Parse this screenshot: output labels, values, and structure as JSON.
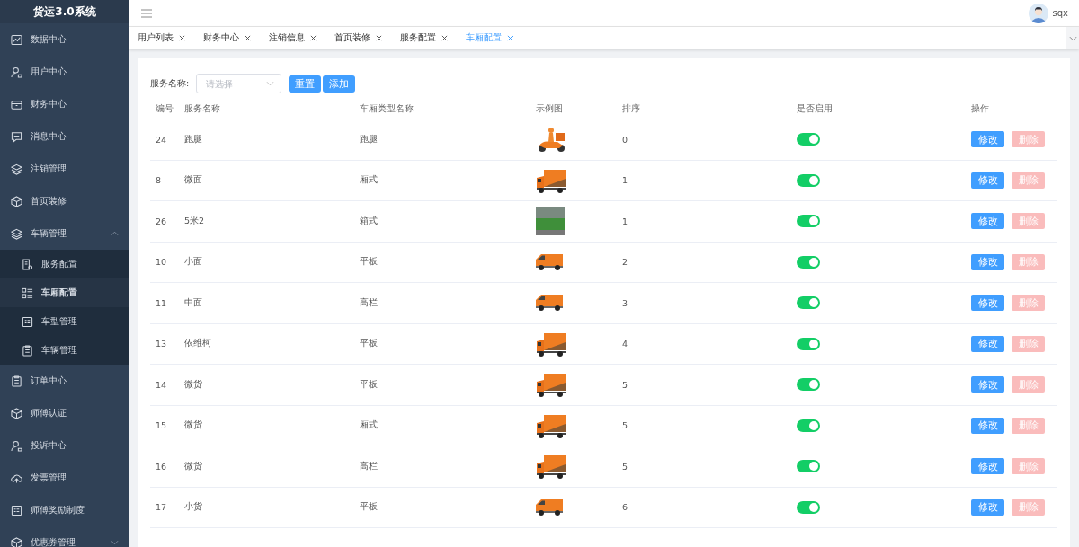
{
  "app_title": "货运3.0系统",
  "sidebar": {
    "items": [
      {
        "label": "数据中心",
        "selected": false
      },
      {
        "label": "用户中心",
        "selected": false
      },
      {
        "label": "财务中心",
        "selected": false
      },
      {
        "label": "消息中心",
        "selected": false
      },
      {
        "label": "注销管理",
        "selected": false
      },
      {
        "label": "首页装修",
        "selected": false
      },
      {
        "label": "车辆管理",
        "selected": false,
        "expanded": true,
        "children": [
          {
            "label": "服务配置",
            "selected": false
          },
          {
            "label": "车厢配置",
            "selected": true
          },
          {
            "label": "车型管理",
            "selected": false
          },
          {
            "label": "车辆管理",
            "selected": false
          }
        ]
      },
      {
        "label": "订单中心",
        "selected": false
      },
      {
        "label": "师傅认证",
        "selected": false
      },
      {
        "label": "投诉中心",
        "selected": false
      },
      {
        "label": "发票管理",
        "selected": false
      },
      {
        "label": "师傅奖励制度",
        "selected": false
      },
      {
        "label": "优惠券管理",
        "selected": false,
        "expanded": false
      }
    ]
  },
  "user": {
    "name": "sqx"
  },
  "tabs": [
    {
      "label": "用户列表",
      "selected": false
    },
    {
      "label": "财务中心",
      "selected": false
    },
    {
      "label": "注销信息",
      "selected": false
    },
    {
      "label": "首页装修",
      "selected": false
    },
    {
      "label": "服务配置",
      "selected": false
    },
    {
      "label": "车厢配置",
      "selected": true
    }
  ],
  "filter": {
    "label": "服务名称:",
    "placeholder": "请选择",
    "buttons": [
      "重置",
      "添加"
    ]
  },
  "table": {
    "columns": [
      "编号",
      "服务名称",
      "车厢类型名称",
      "示例图",
      "排序",
      "是否启用",
      "操作"
    ],
    "rows": [
      {
        "id": "24",
        "service": "跑腿",
        "type": "跑腿",
        "kind": "scooter",
        "order": "0",
        "enabled": true,
        "actions": [
          {
            "label": "修改",
            "disabled": false
          },
          {
            "label": "删除",
            "disabled": true
          }
        ]
      },
      {
        "id": "8",
        "service": "微面",
        "type": "厢式",
        "kind": "truck",
        "order": "1",
        "enabled": true,
        "actions": [
          {
            "label": "修改",
            "disabled": false
          },
          {
            "label": "删除",
            "disabled": true
          }
        ]
      },
      {
        "id": "26",
        "service": "5米2",
        "type": "箱式",
        "kind": "photo",
        "order": "1",
        "enabled": true,
        "actions": [
          {
            "label": "修改",
            "disabled": false
          },
          {
            "label": "删除",
            "disabled": true
          }
        ]
      },
      {
        "id": "10",
        "service": "小面",
        "type": "平板",
        "kind": "van",
        "order": "2",
        "enabled": true,
        "actions": [
          {
            "label": "修改",
            "disabled": false
          },
          {
            "label": "删除",
            "disabled": true
          }
        ]
      },
      {
        "id": "11",
        "service": "中面",
        "type": "高栏",
        "kind": "van",
        "order": "3",
        "enabled": true,
        "actions": [
          {
            "label": "修改",
            "disabled": false
          },
          {
            "label": "删除",
            "disabled": true
          }
        ]
      },
      {
        "id": "13",
        "service": "依维柯",
        "type": "平板",
        "kind": "truck",
        "order": "4",
        "enabled": true,
        "actions": [
          {
            "label": "修改",
            "disabled": false
          },
          {
            "label": "删除",
            "disabled": true
          }
        ]
      },
      {
        "id": "14",
        "service": "微货",
        "type": "平板",
        "kind": "truck",
        "order": "5",
        "enabled": true,
        "actions": [
          {
            "label": "修改",
            "disabled": false
          },
          {
            "label": "删除",
            "disabled": true
          }
        ]
      },
      {
        "id": "15",
        "service": "微货",
        "type": "厢式",
        "kind": "truck",
        "order": "5",
        "enabled": true,
        "actions": [
          {
            "label": "修改",
            "disabled": false
          },
          {
            "label": "删除",
            "disabled": true
          }
        ]
      },
      {
        "id": "16",
        "service": "微货",
        "type": "高栏",
        "kind": "truck",
        "order": "5",
        "enabled": true,
        "actions": [
          {
            "label": "修改",
            "disabled": false
          },
          {
            "label": "删除",
            "disabled": true
          }
        ]
      },
      {
        "id": "17",
        "service": "小货",
        "type": "平板",
        "kind": "van",
        "order": "6",
        "enabled": true,
        "actions": [
          {
            "label": "修改",
            "disabled": false
          },
          {
            "label": "删除",
            "disabled": true
          }
        ]
      }
    ]
  }
}
